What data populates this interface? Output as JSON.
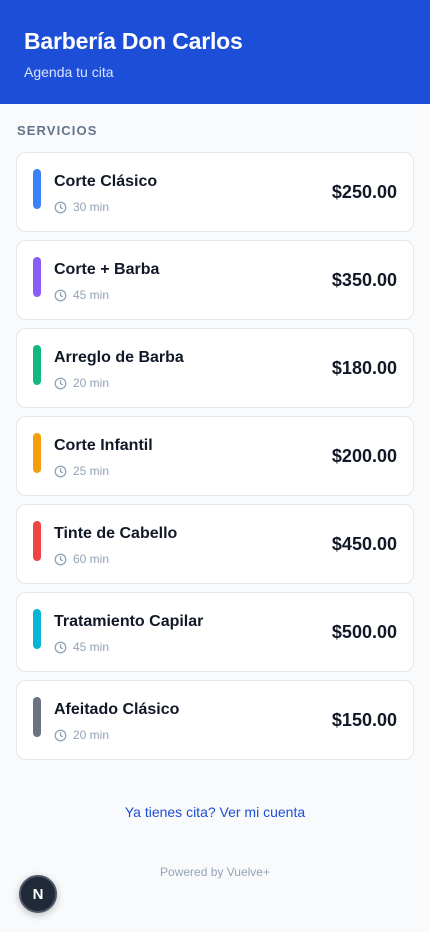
{
  "header": {
    "title": "Barbería Don Carlos",
    "subtitle": "Agenda tu cita",
    "background_color": "#1d4ed8"
  },
  "section_label": "SERVICIOS",
  "services": [
    {
      "name": "Corte Clásico",
      "duration": "30 min",
      "price": "$250.00",
      "accent_color": "#3b82f6"
    },
    {
      "name": "Corte + Barba",
      "duration": "45 min",
      "price": "$350.00",
      "accent_color": "#8b5cf6"
    },
    {
      "name": "Arreglo de Barba",
      "duration": "20 min",
      "price": "$180.00",
      "accent_color": "#10b981"
    },
    {
      "name": "Corte Infantil",
      "duration": "25 min",
      "price": "$200.00",
      "accent_color": "#f59e0b"
    },
    {
      "name": "Tinte de Cabello",
      "duration": "60 min",
      "price": "$450.00",
      "accent_color": "#ef4444"
    },
    {
      "name": "Tratamiento Capilar",
      "duration": "45 min",
      "price": "$500.00",
      "accent_color": "#06b6d4"
    },
    {
      "name": "Afeitado Clásico",
      "duration": "20 min",
      "price": "$150.00",
      "accent_color": "#6b7280"
    }
  ],
  "footer": {
    "account_link": "Ya tienes cita? Ver mi cuenta",
    "powered_by": "Powered by Vuelve+",
    "badge_letter": "N"
  },
  "icons": {
    "duration": "clock-icon"
  }
}
